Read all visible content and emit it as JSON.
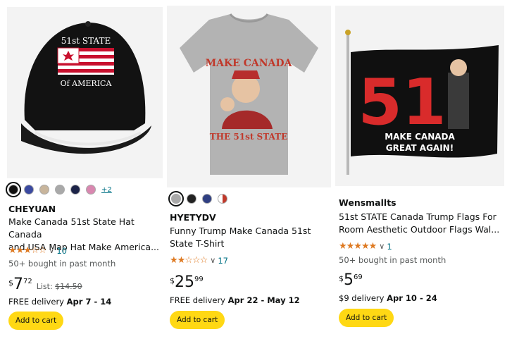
{
  "products": [
    {
      "brand": "CHEYUAN",
      "title_line1": "Make Canada 51st State Hat Canada",
      "title_line2": "and USA Map Hat Make America...",
      "stars": "★★★☆☆",
      "rating_count": "10",
      "bought": "50+ bought in past month",
      "price_currency": "$",
      "price_whole": "7",
      "price_fraction": "72",
      "list_label": "List:",
      "list_price": "$14.50",
      "delivery_prefix": "FREE delivery",
      "delivery_dates": "Apr 7 - 14",
      "button": "Add to cart",
      "swatch_more": "+2",
      "swatches": [
        "#111111",
        "#3b4aa0",
        "#c8b59c",
        "#a9a9a9",
        "#1c2348",
        "#d987b0",
        "#e9e9e9"
      ],
      "image_text_1": "51st STATE",
      "image_text_2": "Of AMERICA"
    },
    {
      "brand": "HYETYDV",
      "title_line1": "Funny Trump Make Canada 51st",
      "title_line2": "State T-Shirt",
      "stars": "★★☆☆☆",
      "rating_count": "17",
      "price_currency": "$",
      "price_whole": "25",
      "price_fraction": "99",
      "delivery_prefix": "FREE delivery",
      "delivery_dates": "Apr 22 - May 12",
      "button": "Add to cart",
      "swatches": [
        "#a9a9a9",
        "#222222",
        "#2f3f82",
        "#c0392b"
      ],
      "image_text_1": "MAKE CANADA",
      "image_text_2": "THE 51st STATE"
    },
    {
      "brand": "Wensmallts",
      "title_line1": "51st STATE Canada Trump Flags For",
      "title_line2": "Room Aesthetic Outdoor Flags Wal...",
      "stars": "★★★★★",
      "rating_count": "1",
      "bought": "50+ bought in past month",
      "price_currency": "$",
      "price_whole": "5",
      "price_fraction": "69",
      "delivery_prefix": "$9 delivery",
      "delivery_dates": "Apr 10 - 24",
      "button": "Add to cart",
      "image_text_1": "51",
      "image_text_2": "MAKE CANADA",
      "image_text_3": "GREAT AGAIN!"
    }
  ]
}
